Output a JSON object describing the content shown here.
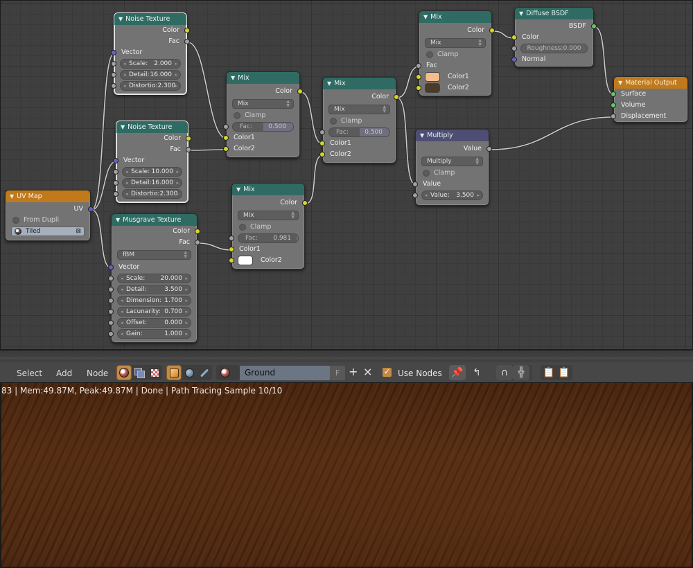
{
  "nodes": {
    "noise1": {
      "title": "Noise Texture",
      "outputs": [
        "Color",
        "Fac"
      ],
      "vector_label": "Vector",
      "fields": [
        {
          "label": "Scale:",
          "value": "2.000"
        },
        {
          "label": "Detail:",
          "value": "16.000"
        },
        {
          "label": "Distortio:",
          "value": "2.300"
        }
      ]
    },
    "noise2": {
      "title": "Noise Texture",
      "outputs": [
        "Color",
        "Fac"
      ],
      "vector_label": "Vector",
      "fields": [
        {
          "label": "Scale:",
          "value": "10.000"
        },
        {
          "label": "Detail:",
          "value": "16.000"
        },
        {
          "label": "Distortio:",
          "value": "2.300"
        }
      ]
    },
    "uvmap": {
      "title": "UV Map",
      "output": "UV",
      "checkbox_label": "From Dupli",
      "uv_layer": "Tiled"
    },
    "musgrave": {
      "title": "Musgrave Texture",
      "outputs": [
        "Color",
        "Fac"
      ],
      "type": "fBM",
      "vector_label": "Vector",
      "fields": [
        {
          "label": "Scale:",
          "value": "20.000"
        },
        {
          "label": "Detail:",
          "value": "3.500"
        },
        {
          "label": "Dimension:",
          "value": "1.700"
        },
        {
          "label": "Lacunarity:",
          "value": "0.700"
        },
        {
          "label": "Offset:",
          "value": "0.000"
        },
        {
          "label": "Gain:",
          "value": "1.000"
        }
      ]
    },
    "mix1": {
      "title": "Mix",
      "output": "Color",
      "blend": "Mix",
      "clamp_label": "Clamp",
      "fac_label": "Fac:",
      "fac_value": "0.500",
      "fac_fraction": 0.5,
      "inputs": [
        "Color1",
        "Color2"
      ]
    },
    "mix2": {
      "title": "Mix",
      "output": "Color",
      "blend": "Mix",
      "clamp_label": "Clamp",
      "fac_label": "Fac:",
      "fac_value": "0.500",
      "fac_fraction": 0.5,
      "inputs": [
        "Color1",
        "Color2"
      ]
    },
    "mix3": {
      "title": "Mix",
      "output": "Color",
      "blend": "Mix",
      "clamp_label": "Clamp",
      "fac_label": "Fac:",
      "fac_value": "0.981",
      "fac_fraction": 0.981,
      "inputs": [
        "Color1",
        "Color2"
      ],
      "color2_swatch": "#ffffff"
    },
    "mix4": {
      "title": "Mix",
      "output": "Color",
      "blend": "Mix",
      "clamp_label": "Clamp",
      "fac_label": "Fac",
      "inputs": [
        "Color1",
        "Color2"
      ],
      "color1_swatch": "#f3be8a",
      "color2_swatch": "#4a3a2a"
    },
    "diffuse": {
      "title": "Diffuse BSDF",
      "output": "BSDF",
      "color_label": "Color",
      "roughness": "Roughness:0.000",
      "normal_label": "Normal"
    },
    "multiply": {
      "title": "Multiply",
      "output": "Value",
      "operation": "Multiply",
      "clamp_label": "Clamp",
      "input_label": "Value",
      "value_label": "Value:",
      "value": "3.500"
    },
    "output": {
      "title": "Material Output",
      "inputs": [
        "Surface",
        "Volume",
        "Displacement"
      ]
    }
  },
  "header": {
    "menu": [
      "Select",
      "Add",
      "Node"
    ],
    "material_name": "Ground",
    "fake_user": "F",
    "add_symbol": "+",
    "remove_symbol": "×",
    "use_nodes_label": "Use Nodes",
    "use_nodes_checked": true
  },
  "status": {
    "text": "83 | Mem:49.87M, Peak:49.87M | Done | Path Tracing Sample 10/10"
  },
  "colors": {
    "socket_color": "#d4d62c",
    "socket_float": "#a1a1a1",
    "socket_vector": "#6364c9",
    "socket_shader": "#63c763",
    "header_texture": "#2f6b63",
    "header_output": "#c07a1c",
    "header_converter": "#4e4e74",
    "active_button": "#c28a47"
  }
}
